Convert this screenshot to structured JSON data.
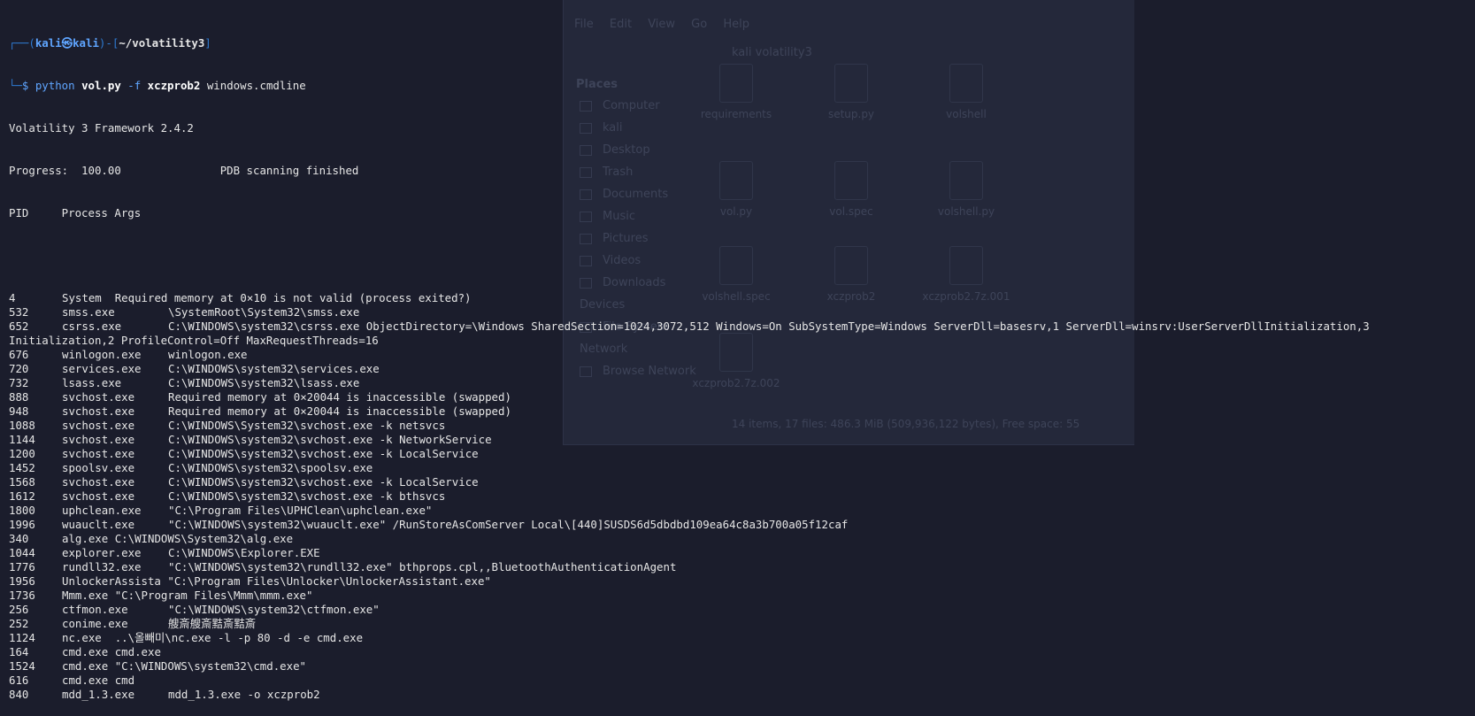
{
  "background_window": {
    "menu": "File  Edit  View  Go  Help",
    "path": "kali   volatility3",
    "places_title": "Places",
    "places": [
      "Computer",
      "kali",
      "Desktop",
      "Trash",
      "Documents",
      "Music",
      "Pictures",
      "Videos",
      "Downloads"
    ],
    "devices_title": "Devices",
    "devices": [
      "File System"
    ],
    "network_title": "Network",
    "network": [
      "Browse Network"
    ],
    "files": [
      "requirements",
      "setup.py",
      "volshell",
      "vol.py",
      "vol.spec",
      "volshell.py",
      "volshell.spec",
      "xczprob2",
      "xczprob2.7z.001",
      "xczprob2.7z.002"
    ],
    "status": "14 items, 17 files: 486.3 MiB (509,936,122 bytes), Free space: 55"
  },
  "terminal": {
    "prompt": {
      "open": "┌──(",
      "user": "kali㉿kali",
      "close": ")-[",
      "dir": "~/volatility3",
      "end": "]",
      "line2": "└─",
      "dollar": "$ ",
      "cmd_python": "python ",
      "cmd_script": "vol.py",
      "cmd_flag": " -f ",
      "cmd_file": "xczprob2",
      "cmd_plugin": " windows.cmdline"
    },
    "version_line": "Volatility 3 Framework 2.4.2",
    "progress_line": "Progress:  100.00               PDB scanning finished",
    "header": "PID     Process Args",
    "rows": [
      {
        "pid": "4",
        "proc": "System",
        "args": "Required memory at 0×10 is not valid (process exited?)",
        "compact": true,
        "sep": "  "
      },
      {
        "pid": "532",
        "proc": "smss.exe",
        "args": "\\SystemRoot\\System32\\smss.exe"
      },
      {
        "pid": "652",
        "proc": "csrss.exe",
        "args": "C:\\WINDOWS\\system32\\csrss.exe ObjectDirectory=\\Windows SharedSection=1024,3072,512 Windows=On SubSystemType=Windows ServerDll=basesrv,1 ServerDll=winsrv:UserServerDllInitialization,3"
      },
      {
        "raw": "Initialization,2 ProfileControl=Off MaxRequestThreads=16"
      },
      {
        "pid": "676",
        "proc": "winlogon.exe",
        "args": "winlogon.exe"
      },
      {
        "pid": "720",
        "proc": "services.exe",
        "args": "C:\\WINDOWS\\system32\\services.exe"
      },
      {
        "pid": "732",
        "proc": "lsass.exe",
        "args": "C:\\WINDOWS\\system32\\lsass.exe"
      },
      {
        "pid": "888",
        "proc": "svchost.exe",
        "args": "Required memory at 0×20044 is inaccessible (swapped)"
      },
      {
        "pid": "948",
        "proc": "svchost.exe",
        "args": "Required memory at 0×20044 is inaccessible (swapped)"
      },
      {
        "pid": "1088",
        "proc": "svchost.exe",
        "args": "C:\\WINDOWS\\System32\\svchost.exe -k netsvcs"
      },
      {
        "pid": "1144",
        "proc": "svchost.exe",
        "args": "C:\\WINDOWS\\system32\\svchost.exe -k NetworkService"
      },
      {
        "pid": "1200",
        "proc": "svchost.exe",
        "args": "C:\\WINDOWS\\system32\\svchost.exe -k LocalService"
      },
      {
        "pid": "1452",
        "proc": "spoolsv.exe",
        "args": "C:\\WINDOWS\\system32\\spoolsv.exe"
      },
      {
        "pid": "1568",
        "proc": "svchost.exe",
        "args": "C:\\WINDOWS\\system32\\svchost.exe -k LocalService"
      },
      {
        "pid": "1612",
        "proc": "svchost.exe",
        "args": "C:\\WINDOWS\\system32\\svchost.exe -k bthsvcs"
      },
      {
        "pid": "1800",
        "proc": "uphclean.exe",
        "args": "\"C:\\Program Files\\UPHClean\\uphclean.exe\""
      },
      {
        "pid": "1996",
        "proc": "wuauclt.exe",
        "args": "\"C:\\WINDOWS\\system32\\wuauclt.exe\" /RunStoreAsComServer Local\\[440]SUSDS6d5dbdbd109ea64c8a3b700a05f12caf"
      },
      {
        "pid": "340",
        "proc": "alg.exe",
        "args": "C:\\WINDOWS\\System32\\alg.exe",
        "compact": true,
        "sep": " "
      },
      {
        "pid": "1044",
        "proc": "explorer.exe",
        "args": "C:\\WINDOWS\\Explorer.EXE"
      },
      {
        "pid": "1776",
        "proc": "rundll32.exe",
        "args": "\"C:\\WINDOWS\\system32\\rundll32.exe\" bthprops.cpl,,BluetoothAuthenticationAgent"
      },
      {
        "pid": "1956",
        "proc": "UnlockerAssista",
        "args": "\"C:\\Program Files\\Unlocker\\UnlockerAssistant.exe\"",
        "compact": true,
        "sep": " "
      },
      {
        "pid": "1736",
        "proc": "Mmm.exe",
        "args": "\"C:\\Program Files\\Mmm\\mmm.exe\"",
        "compact": true,
        "sep": " "
      },
      {
        "pid": "256",
        "proc": "ctfmon.exe",
        "args": "\"C:\\WINDOWS\\system32\\ctfmon.exe\""
      },
      {
        "pid": "252",
        "proc": "conime.exe",
        "args": "艘斎艘斎黠斎黠斎"
      },
      {
        "pid": "1124",
        "proc": "nc.exe",
        "args": "..\\올빼미\\nc.exe -l -p 80 -d -e cmd.exe",
        "compact": true,
        "sep": "  "
      },
      {
        "pid": "164",
        "proc": "cmd.exe",
        "args": "cmd.exe",
        "compact": true,
        "sep": " "
      },
      {
        "pid": "1524",
        "proc": "cmd.exe",
        "args": "\"C:\\WINDOWS\\system32\\cmd.exe\"",
        "compact": true,
        "sep": " "
      },
      {
        "pid": "616",
        "proc": "cmd.exe",
        "args": "cmd",
        "compact": true,
        "sep": " "
      },
      {
        "pid": "840",
        "proc": "mdd_1.3.exe",
        "args": "mdd_1.3.exe -o xczprob2"
      }
    ]
  }
}
